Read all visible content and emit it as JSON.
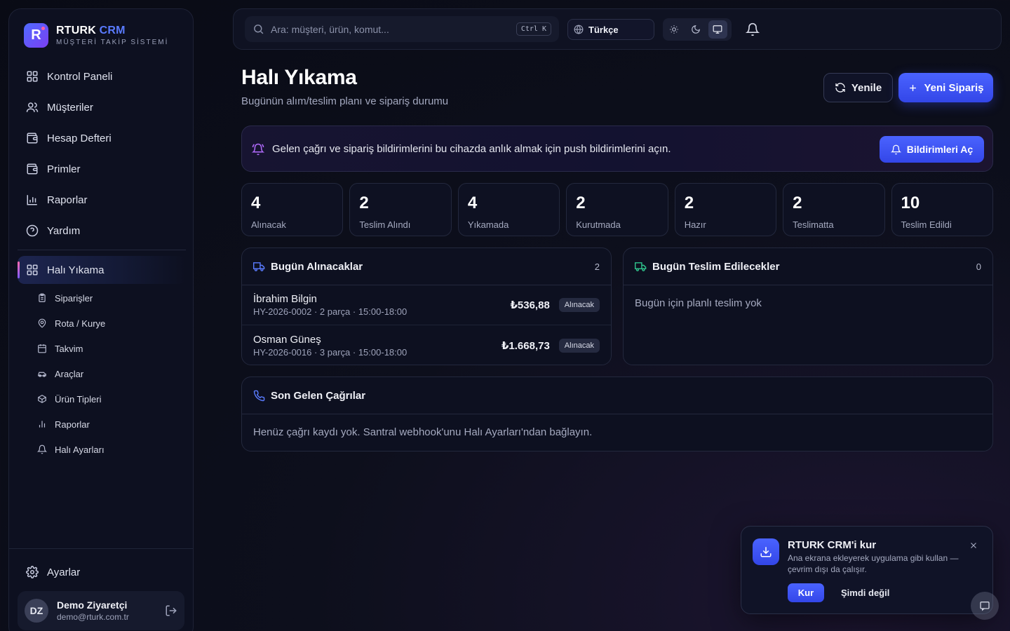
{
  "brand": {
    "name_main": "RTURK",
    "name_accent": "CRM",
    "subtitle": "MÜŞTERİ TAKİP SİSTEMİ",
    "logo_letter": "R"
  },
  "sidebar": {
    "items": [
      {
        "label": "Kontrol Paneli",
        "icon": "dashboard-icon"
      },
      {
        "label": "Müşteriler",
        "icon": "users-icon"
      },
      {
        "label": "Hesap Defteri",
        "icon": "wallet-icon"
      },
      {
        "label": "Primler",
        "icon": "wallet-icon"
      },
      {
        "label": "Raporlar",
        "icon": "bar-chart-icon"
      },
      {
        "label": "Yardım",
        "icon": "help-circle-icon"
      }
    ],
    "active_section": {
      "label": "Halı Yıkama",
      "icon": "dashboard-icon"
    },
    "sub_items": [
      {
        "label": "Siparişler",
        "icon": "clipboard-icon"
      },
      {
        "label": "Rota / Kurye",
        "icon": "map-pin-icon"
      },
      {
        "label": "Takvim",
        "icon": "calendar-icon"
      },
      {
        "label": "Araçlar",
        "icon": "car-icon"
      },
      {
        "label": "Ürün Tipleri",
        "icon": "package-icon"
      },
      {
        "label": "Raporlar",
        "icon": "bar-chart-icon"
      },
      {
        "label": "Halı Ayarları",
        "icon": "bell-icon"
      }
    ],
    "settings_label": "Ayarlar",
    "user": {
      "initials": "DZ",
      "name": "Demo Ziyaretçi",
      "email": "demo@rturk.com.tr"
    }
  },
  "topbar": {
    "search_placeholder": "Ara: müşteri, ürün, komut...",
    "search_shortcut": "Ctrl K",
    "language": "Türkçe",
    "theme_active": "system"
  },
  "page": {
    "title": "Halı Yıkama",
    "subtitle": "Bugünün alım/teslim planı ve sipariş durumu",
    "refresh_label": "Yenile",
    "new_order_label": "Yeni Sipariş"
  },
  "notice": {
    "text": "Gelen çağrı ve sipariş bildirimlerini bu cihazda anlık almak için push bildirimlerini açın.",
    "button_label": "Bildirimleri Aç"
  },
  "stats": [
    {
      "value": "4",
      "label": "Alınacak"
    },
    {
      "value": "2",
      "label": "Teslim Alındı"
    },
    {
      "value": "4",
      "label": "Yıkamada"
    },
    {
      "value": "2",
      "label": "Kurutmada"
    },
    {
      "value": "2",
      "label": "Hazır"
    },
    {
      "value": "2",
      "label": "Teslimatta"
    },
    {
      "value": "10",
      "label": "Teslim Edildi"
    }
  ],
  "pickups": {
    "title": "Bugün Alınacaklar",
    "count": "2",
    "rows": [
      {
        "name": "İbrahim Bilgin",
        "meta": "HY-2026-0002 · 2 parça · 15:00-18:00",
        "amount": "₺536,88",
        "status": "Alınacak"
      },
      {
        "name": "Osman Güneş",
        "meta": "HY-2026-0016 · 3 parça · 15:00-18:00",
        "amount": "₺1.668,73",
        "status": "Alınacak"
      }
    ]
  },
  "deliveries": {
    "title": "Bugün Teslim Edilecekler",
    "count": "0",
    "empty_text": "Bugün için planlı teslim yok"
  },
  "calls": {
    "title": "Son Gelen Çağrılar",
    "empty_text": "Henüz çağrı kaydı yok. Santral webhook'unu Halı Ayarları'ndan bağlayın."
  },
  "install_toast": {
    "title": "RTURK CRM'i kur",
    "description": "Ana ekrana ekleyerek uygulama gibi kullan — çevrim dışı da çalışır.",
    "install_label": "Kur",
    "later_label": "Şimdi değil"
  },
  "colors": {
    "accent": "#4a63ff",
    "background": "#090b15",
    "card": "#0d1020",
    "notice_icon": "#b36bff",
    "pickup_icon": "#5a7bff",
    "delivery_icon": "#2fc48d"
  }
}
